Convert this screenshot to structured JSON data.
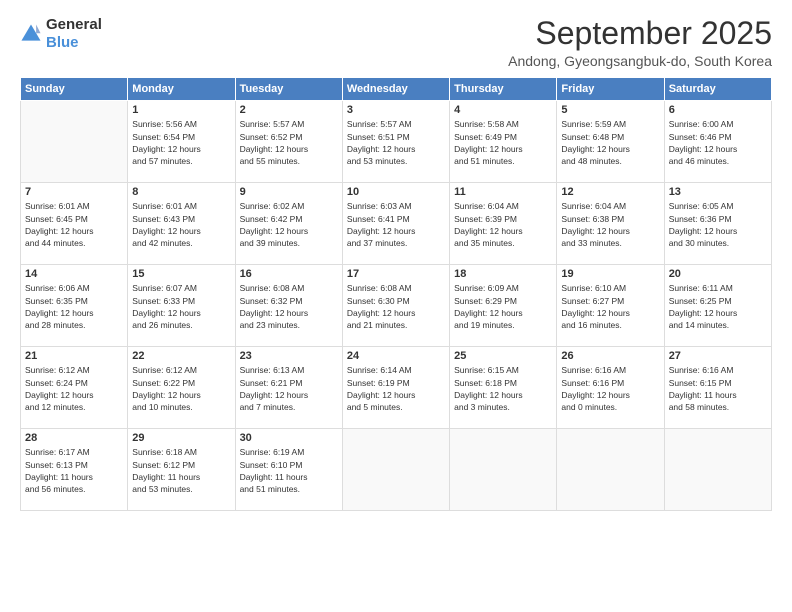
{
  "logo": {
    "text_general": "General",
    "text_blue": "Blue"
  },
  "header": {
    "month": "September 2025",
    "location": "Andong, Gyeongsangbuk-do, South Korea"
  },
  "weekdays": [
    "Sunday",
    "Monday",
    "Tuesday",
    "Wednesday",
    "Thursday",
    "Friday",
    "Saturday"
  ],
  "weeks": [
    [
      {
        "day": "",
        "info": ""
      },
      {
        "day": "1",
        "info": "Sunrise: 5:56 AM\nSunset: 6:54 PM\nDaylight: 12 hours\nand 57 minutes."
      },
      {
        "day": "2",
        "info": "Sunrise: 5:57 AM\nSunset: 6:52 PM\nDaylight: 12 hours\nand 55 minutes."
      },
      {
        "day": "3",
        "info": "Sunrise: 5:57 AM\nSunset: 6:51 PM\nDaylight: 12 hours\nand 53 minutes."
      },
      {
        "day": "4",
        "info": "Sunrise: 5:58 AM\nSunset: 6:49 PM\nDaylight: 12 hours\nand 51 minutes."
      },
      {
        "day": "5",
        "info": "Sunrise: 5:59 AM\nSunset: 6:48 PM\nDaylight: 12 hours\nand 48 minutes."
      },
      {
        "day": "6",
        "info": "Sunrise: 6:00 AM\nSunset: 6:46 PM\nDaylight: 12 hours\nand 46 minutes."
      }
    ],
    [
      {
        "day": "7",
        "info": "Sunrise: 6:01 AM\nSunset: 6:45 PM\nDaylight: 12 hours\nand 44 minutes."
      },
      {
        "day": "8",
        "info": "Sunrise: 6:01 AM\nSunset: 6:43 PM\nDaylight: 12 hours\nand 42 minutes."
      },
      {
        "day": "9",
        "info": "Sunrise: 6:02 AM\nSunset: 6:42 PM\nDaylight: 12 hours\nand 39 minutes."
      },
      {
        "day": "10",
        "info": "Sunrise: 6:03 AM\nSunset: 6:41 PM\nDaylight: 12 hours\nand 37 minutes."
      },
      {
        "day": "11",
        "info": "Sunrise: 6:04 AM\nSunset: 6:39 PM\nDaylight: 12 hours\nand 35 minutes."
      },
      {
        "day": "12",
        "info": "Sunrise: 6:04 AM\nSunset: 6:38 PM\nDaylight: 12 hours\nand 33 minutes."
      },
      {
        "day": "13",
        "info": "Sunrise: 6:05 AM\nSunset: 6:36 PM\nDaylight: 12 hours\nand 30 minutes."
      }
    ],
    [
      {
        "day": "14",
        "info": "Sunrise: 6:06 AM\nSunset: 6:35 PM\nDaylight: 12 hours\nand 28 minutes."
      },
      {
        "day": "15",
        "info": "Sunrise: 6:07 AM\nSunset: 6:33 PM\nDaylight: 12 hours\nand 26 minutes."
      },
      {
        "day": "16",
        "info": "Sunrise: 6:08 AM\nSunset: 6:32 PM\nDaylight: 12 hours\nand 23 minutes."
      },
      {
        "day": "17",
        "info": "Sunrise: 6:08 AM\nSunset: 6:30 PM\nDaylight: 12 hours\nand 21 minutes."
      },
      {
        "day": "18",
        "info": "Sunrise: 6:09 AM\nSunset: 6:29 PM\nDaylight: 12 hours\nand 19 minutes."
      },
      {
        "day": "19",
        "info": "Sunrise: 6:10 AM\nSunset: 6:27 PM\nDaylight: 12 hours\nand 16 minutes."
      },
      {
        "day": "20",
        "info": "Sunrise: 6:11 AM\nSunset: 6:25 PM\nDaylight: 12 hours\nand 14 minutes."
      }
    ],
    [
      {
        "day": "21",
        "info": "Sunrise: 6:12 AM\nSunset: 6:24 PM\nDaylight: 12 hours\nand 12 minutes."
      },
      {
        "day": "22",
        "info": "Sunrise: 6:12 AM\nSunset: 6:22 PM\nDaylight: 12 hours\nand 10 minutes."
      },
      {
        "day": "23",
        "info": "Sunrise: 6:13 AM\nSunset: 6:21 PM\nDaylight: 12 hours\nand 7 minutes."
      },
      {
        "day": "24",
        "info": "Sunrise: 6:14 AM\nSunset: 6:19 PM\nDaylight: 12 hours\nand 5 minutes."
      },
      {
        "day": "25",
        "info": "Sunrise: 6:15 AM\nSunset: 6:18 PM\nDaylight: 12 hours\nand 3 minutes."
      },
      {
        "day": "26",
        "info": "Sunrise: 6:16 AM\nSunset: 6:16 PM\nDaylight: 12 hours\nand 0 minutes."
      },
      {
        "day": "27",
        "info": "Sunrise: 6:16 AM\nSunset: 6:15 PM\nDaylight: 11 hours\nand 58 minutes."
      }
    ],
    [
      {
        "day": "28",
        "info": "Sunrise: 6:17 AM\nSunset: 6:13 PM\nDaylight: 11 hours\nand 56 minutes."
      },
      {
        "day": "29",
        "info": "Sunrise: 6:18 AM\nSunset: 6:12 PM\nDaylight: 11 hours\nand 53 minutes."
      },
      {
        "day": "30",
        "info": "Sunrise: 6:19 AM\nSunset: 6:10 PM\nDaylight: 11 hours\nand 51 minutes."
      },
      {
        "day": "",
        "info": ""
      },
      {
        "day": "",
        "info": ""
      },
      {
        "day": "",
        "info": ""
      },
      {
        "day": "",
        "info": ""
      }
    ]
  ]
}
